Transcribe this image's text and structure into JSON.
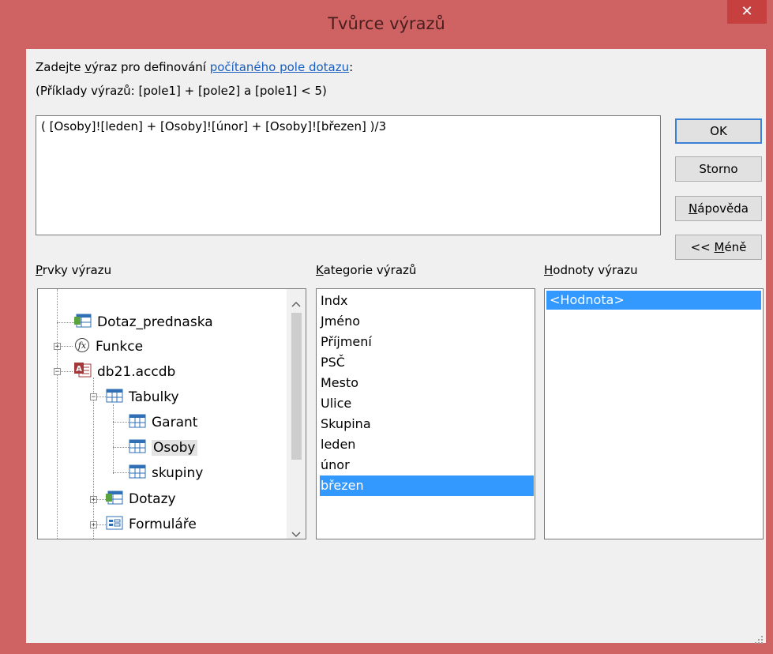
{
  "window": {
    "title": "Tvůrce výrazů",
    "close_glyph": "✕"
  },
  "header": {
    "line1_prefix": "Zadejte ",
    "line1_accel": "v",
    "line1_mid": "ýraz pro definování ",
    "line1_link": "počítaného pole dotazu",
    "line1_suffix": ":",
    "line2": "(Příklady výrazů: [pole1] + [pole2] a [pole1] < 5)"
  },
  "expression": "( [Osoby]![leden] + [Osoby]![únor] + [Osoby]![březen] )/3",
  "buttons": {
    "ok": "OK",
    "cancel": "Storno",
    "help_accel": "N",
    "help_rest": "ápověda",
    "less_prefix": "<< ",
    "less_accel": "M",
    "less_rest": "éně"
  },
  "panels": {
    "elements_label_accel": "P",
    "elements_label_rest": "rvky výrazu",
    "categories_label_accel": "K",
    "categories_label_rest": "ategorie výrazů",
    "values_label_accel": "H",
    "values_label_rest": "odnoty výrazu"
  },
  "tree": [
    {
      "label": "Dotaz_prednaska",
      "icon": "query-icon"
    },
    {
      "label": "Funkce",
      "icon": "function-icon"
    },
    {
      "label": "db21.accdb",
      "icon": "access-db-icon"
    },
    {
      "label": "Tabulky",
      "icon": "table-icon"
    },
    {
      "label": "Garant",
      "icon": "table-icon"
    },
    {
      "label": "Osoby",
      "icon": "table-icon"
    },
    {
      "label": "skupiny",
      "icon": "table-icon"
    },
    {
      "label": "Dotazy",
      "icon": "query-icon"
    },
    {
      "label": "Formuláře",
      "icon": "form-icon"
    }
  ],
  "categories": [
    "Indx",
    "Jméno",
    "Příjmení",
    "PSČ",
    "Mesto",
    "Ulice",
    "Skupina",
    "leden",
    "únor",
    "březen"
  ],
  "selected_category": "březen",
  "values": [
    "<Hodnota>"
  ],
  "colors": {
    "titlebar": "#cf6262",
    "selection": "#3399ff",
    "link": "#1a5fc0"
  }
}
